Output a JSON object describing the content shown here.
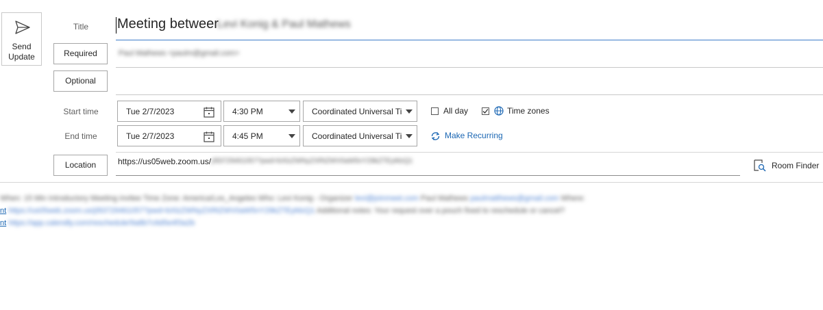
{
  "toolbar": {
    "send_update_label_1": "Send",
    "send_update_label_2": "Update"
  },
  "labels": {
    "title": "Title",
    "required": "Required",
    "optional": "Optional",
    "start_time": "Start time",
    "end_time": "End time",
    "location": "Location"
  },
  "title_value_prefix": "Meeting betweer",
  "title_value_blurred": "Levi Konig & Paul Mathews",
  "required_blurred": "Paul Mathews <paulm@gmail.com>",
  "start": {
    "date": "Tue 2/7/2023",
    "time": "4:30 PM",
    "timezone": "Coordinated Universal Ti"
  },
  "end": {
    "date": "Tue 2/7/2023",
    "time": "4:45 PM",
    "timezone": "Coordinated Universal Ti"
  },
  "options": {
    "all_day": "All day",
    "time_zones": "Time zones",
    "make_recurring": "Make Recurring"
  },
  "location_prefix": "https://us05web.zoom.us/",
  "location_blurred": "j/83729461057?pwd=bXlzZWNyZXRtZWV0aW5nY29kZTEyMzQ1",
  "room_finder": "Room Finder",
  "body": {
    "line1_blurred": "When: 15 Min Introductory Meeting invitee Time Zone: America/Los_Angeles Who: Levi Konig - Organizer",
    "line1_link1": "levi@joinmeet.com",
    "line1_rest": "Paul Mathews",
    "line1_link2": "paulmatthews@gmail.com",
    "line1_end": "Where:",
    "line2_prefix": "nt",
    "line2_link": "https://us05web.zoom.us/j/83729461057?pwd=bXlzZWNyZXRtZWV0aW5nY29kZTEyMzQ1",
    "line2_rest": "Additional notes: Your request over a pouch fixed to reschedule or cancel?",
    "line3_prefix": "nt",
    "line3_link": "https://app.calendly.com/reschedule/9a8b7c6d5e4f3a2b"
  }
}
